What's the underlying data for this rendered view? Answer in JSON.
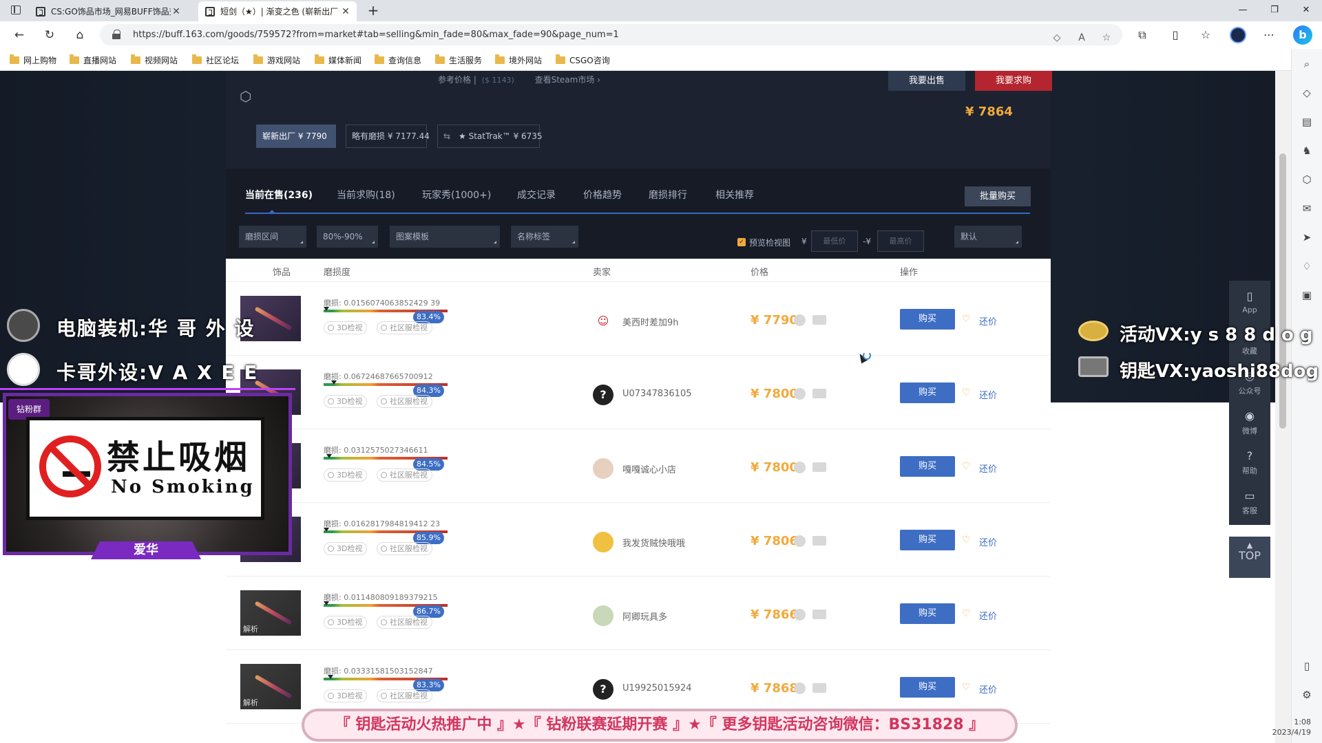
{
  "browser": {
    "tabs": [
      {
        "title": "CS:GO饰品市场_网易BUFF饰品交"
      },
      {
        "title": "短剑（★）| 渐变之色 (崭新出厂"
      }
    ],
    "url": "https://buff.163.com/goods/759572?from=market#tab=selling&min_fade=80&max_fade=90&page_num=1",
    "bookmarks": [
      "网上购物",
      "直播网站",
      "视频网站",
      "社区论坛",
      "游戏网站",
      "媒体新闻",
      "查询信息",
      "生活服务",
      "境外网站",
      "CSGO咨询"
    ]
  },
  "header": {
    "ref_label": "参考价格 |",
    "ref_price": "¥ 7864",
    "ref_usd": "($ 1143)",
    "steam_link": "查看Steam市场 ›",
    "sell_btn": "我要出售",
    "want_btn": "我要求购",
    "chips": [
      {
        "label": "崭新出厂 ¥ 7790",
        "active": true
      },
      {
        "label": "略有磨损 ¥ 7177.44",
        "active": false
      },
      {
        "label": "★ StatTrak™ ¥ 6735",
        "active": false
      }
    ]
  },
  "panel": {
    "tabs": [
      "当前在售(236)",
      "当前求购(18)",
      "玩家秀(1000+)",
      "成交记录",
      "价格趋势",
      "磨损排行",
      "相关推荐"
    ],
    "bulk_btn": "批量购买",
    "filters": {
      "wear_range": "磨损区间",
      "fade": "80%-90%",
      "pattern": "图案模板",
      "name_tag": "名称标签",
      "preview_label": "预览检视图",
      "yen": "¥",
      "min_placeholder": "最低价",
      "dash_yen": "-¥",
      "max_placeholder": "最高价",
      "sort": "默认"
    },
    "columns": {
      "item": "饰品",
      "wear": "磨损度",
      "seller": "卖家",
      "price": "价格",
      "action": "操作"
    },
    "tool_3d": "3D检视",
    "tool_inspect": "社区服检视",
    "buy_label": "购买",
    "bargain_label": "还价",
    "rows": [
      {
        "wear": "磨损: 0.0156074063852429 39",
        "pct": "83.4%",
        "seller": "美西时差加9h",
        "price": "¥ 7790",
        "thumb_tag": ""
      },
      {
        "wear": "磨损: 0.06724687665700912",
        "pct": "84.3%",
        "seller": "U07347836105",
        "price": "¥ 7800",
        "thumb_tag": ""
      },
      {
        "wear": "磨损: 0.0312575027346611",
        "pct": "84.5%",
        "seller": "嘎嘎诚心小店",
        "price": "¥ 7800",
        "thumb_tag": ""
      },
      {
        "wear": "磨损: 0.0162817984819412 23",
        "pct": "85.9%",
        "seller": "我发货贼快哦哦",
        "price": "¥ 7806",
        "thumb_tag": ""
      },
      {
        "wear": "磨损: 0.011480809189379215",
        "pct": "86.7%",
        "seller": "阿卿玩具多",
        "price": "¥ 7866",
        "thumb_tag": "解析"
      },
      {
        "wear": "磨损: 0.03331581503152847",
        "pct": "83.3%",
        "seller": "U19925015924",
        "price": "¥ 7868",
        "thumb_tag": "解析"
      }
    ]
  },
  "float_tools": [
    "App",
    "收藏",
    "公众号",
    "微博",
    "帮助",
    "客服"
  ],
  "top_btn": "TOP",
  "overlay": {
    "left1": "电脑装机:华 哥 外 设",
    "left2": "卡哥外设:V A X E E",
    "right1": "活动VX:y s 8 8 d o g",
    "right2": "钥匙VX:yaoshi88dog",
    "nosmoke_cn": "禁止吸烟",
    "nosmoke_en": "No Smoking",
    "cam_name": "爱华",
    "cam_badge": "钻粉群",
    "marquee": "『 钥匙活动火热推广中 』★『 钻粉联赛延期开赛 』★『 更多钥匙活动咨询微信：BS31828 』"
  },
  "clock": {
    "time": "1:08",
    "date": "2023/4/19"
  }
}
